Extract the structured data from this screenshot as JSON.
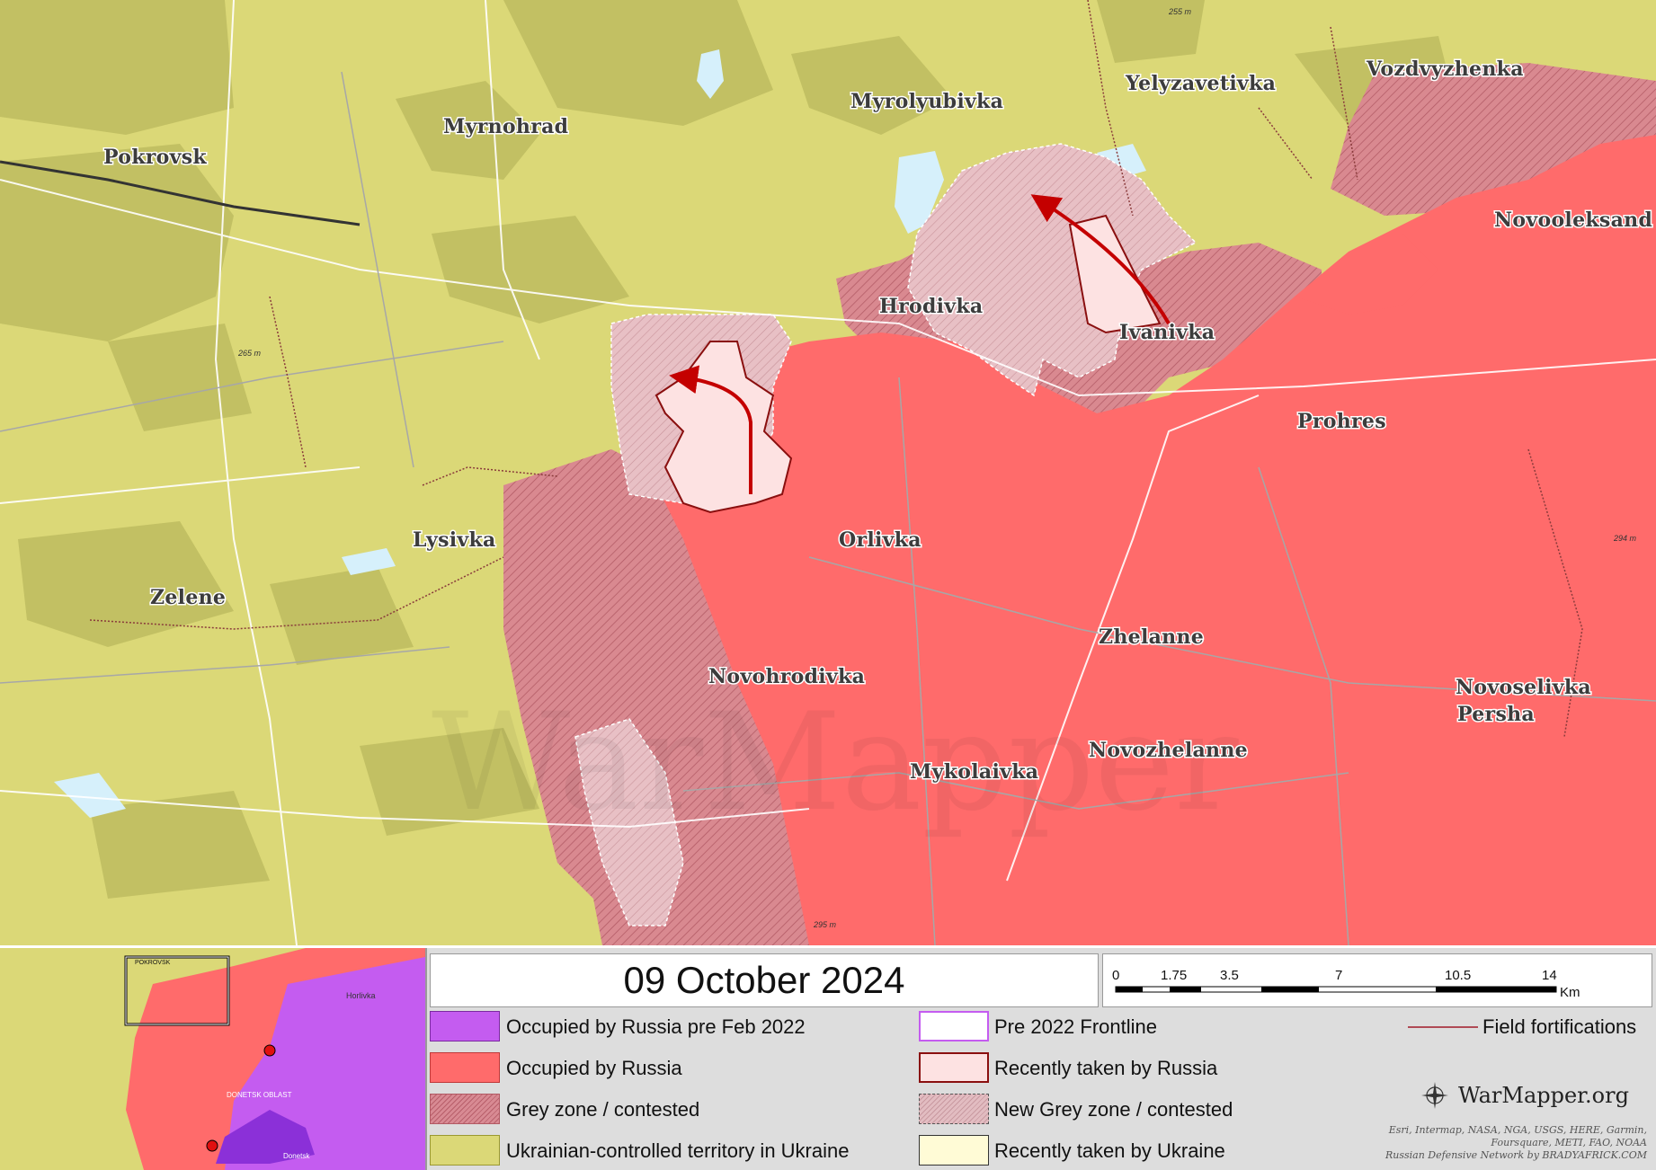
{
  "map": {
    "towns": [
      {
        "name": "Pokrovsk"
      },
      {
        "name": "Myrnohrad"
      },
      {
        "name": "Myrolyubivka"
      },
      {
        "name": "Yelyzavetivka"
      },
      {
        "name": "Vozdvyzhenka"
      },
      {
        "name": "Novooleksand"
      },
      {
        "name": "Hrodivka"
      },
      {
        "name": "Ivanivka"
      },
      {
        "name": "Prohres"
      },
      {
        "name": "Orlivka"
      },
      {
        "name": "Lysivka"
      },
      {
        "name": "Zelene"
      },
      {
        "name": "Zhelanne"
      },
      {
        "name": "Novohrodivka"
      },
      {
        "name": "Novoselivka"
      },
      {
        "name": "Persha"
      },
      {
        "name": "Novozhelanne"
      },
      {
        "name": "Mykolaivka"
      }
    ],
    "elevations": [
      "255 m",
      "265 m",
      "295 m",
      "294 m"
    ],
    "watermark": "WarMapper",
    "colors": {
      "ukraine": "#dbd877",
      "ukraine_dark": "#c2c063",
      "russia": "#ff6b6b",
      "grey_zone": "#d98990",
      "recent_russia": "#fde2e2",
      "water": "#d6f0fb"
    }
  },
  "legend": {
    "date": "09 October 2024",
    "scale": {
      "ticks": [
        "0",
        "1.75",
        "3.5",
        "7",
        "10.5",
        "14"
      ],
      "unit": "Km"
    },
    "items": [
      {
        "label": "Occupied by Russia pre Feb 2022",
        "color": "#c45cf0"
      },
      {
        "label": "Occupied by Russia",
        "color": "#ff6b6b"
      },
      {
        "label": "Grey zone / contested",
        "color": "#d98990"
      },
      {
        "label": "Ukrainian-controlled territory in Ukraine",
        "color": "#dbd877"
      },
      {
        "label": "Pre 2022 Frontline",
        "color": "#ffffff"
      },
      {
        "label": "Recently taken by Russia",
        "color": "#fde2e2"
      },
      {
        "label": "New Grey zone / contested",
        "color": "#e2bcc1"
      },
      {
        "label": "Recently taken by Ukraine",
        "color": "#fffbd6"
      },
      {
        "label": "Field fortifications",
        "color": "#b04a55"
      }
    ],
    "brand": "WarMapper.org",
    "credits": [
      "Esri, Intermap, NASA, NGA, USGS, HERE, Garmin,",
      "Foursquare, METI, FAO, NOAA",
      "Russian Defensive Network by BRADYAFRICK.COM"
    ],
    "inset": {
      "labels": [
        "POKROVSK",
        "Horlivka",
        "DONETSK OBLAST",
        "Donetsk"
      ]
    }
  }
}
